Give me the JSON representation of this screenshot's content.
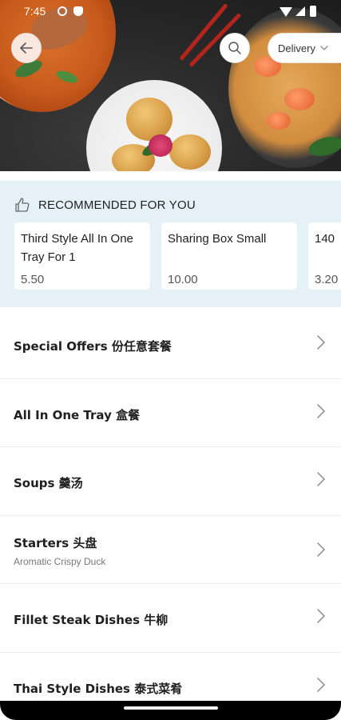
{
  "status_bar": {
    "time": "7:45"
  },
  "header": {
    "delivery_label": "Delivery"
  },
  "recommended": {
    "title": "RECOMMENDED FOR YOU",
    "items": [
      {
        "name": "Third Style All In One Tray For 1",
        "price": "5.50"
      },
      {
        "name": "Sharing Box Small",
        "price": "10.00"
      },
      {
        "name": "140",
        "price": "3.20"
      }
    ]
  },
  "categories": [
    {
      "title": "Special Offers 份任意套餐",
      "subtitle": ""
    },
    {
      "title": "All In One Tray 盒餐",
      "subtitle": ""
    },
    {
      "title": "Soups 羹汤",
      "subtitle": ""
    },
    {
      "title": "Starters 头盘",
      "subtitle": "Aromatic Crispy Duck"
    },
    {
      "title": "Fillet Steak Dishes 牛柳",
      "subtitle": ""
    },
    {
      "title": "Thai Style Dishes 泰式菜肴",
      "subtitle": ""
    }
  ],
  "icons": {
    "back": "arrow-left-icon",
    "search": "search-icon",
    "dropdown": "chevron-down-icon",
    "recommended": "thumbs-up-icon",
    "row": "chevron-right-icon"
  },
  "colors": {
    "recommended_bg": "#e6f1f7",
    "card_bg": "#ffffff",
    "divider": "#ececec"
  }
}
